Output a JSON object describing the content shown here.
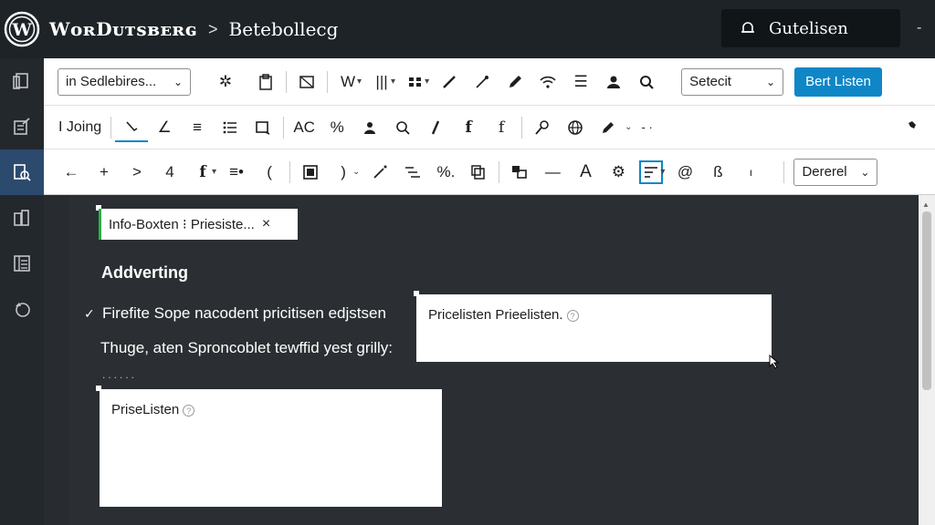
{
  "topbar": {
    "brand": "WᴏʀDᴜᴛsʙᴇʀɢ",
    "separator": ">",
    "breadcrumb": "Betebollecg",
    "action_button": "Gutelisen",
    "more": "-"
  },
  "toolbar": {
    "row1": {
      "block_select": "in Sedlebires...",
      "w_label": "W",
      "style_select": "Setecit",
      "primary_button": "Bert Listen"
    },
    "row2": {
      "join_label": "I Joing",
      "ac_label": "AC",
      "f1": "f",
      "f2": "f",
      "more": "- ·"
    },
    "row3": {
      "f_label": "f",
      "a_label": "A",
      "s_label": "ß",
      "dropdown": "Dererel"
    }
  },
  "editor": {
    "chip_label": "Info-Boxten  ⁝  Priesiste...",
    "chip_close": "×",
    "heading": "Addverting",
    "line1": "Firefite Sope nacodent pricitisen edjstsen",
    "line2": "Thuge, aten Sproncoblet tewffid yest grilly:",
    "dots": "......",
    "box1_text": "Pricelisten Prieelisten.",
    "box2_text": "PriseListen",
    "help_glyph": "?"
  },
  "colors": {
    "admin_bar": "#1d2327",
    "primary": "#0f86c6",
    "accent_green": "#2eae4a",
    "canvas": "#282c30"
  }
}
